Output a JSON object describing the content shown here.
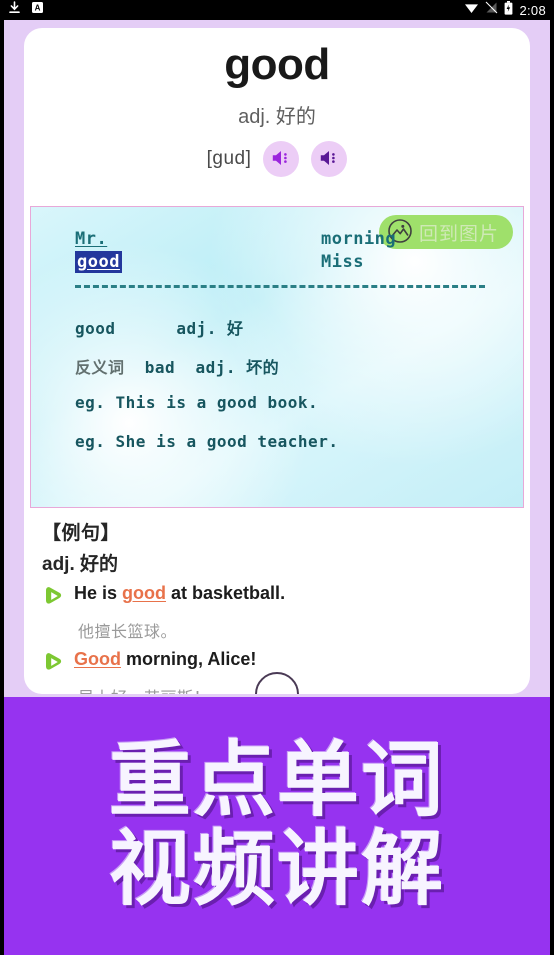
{
  "statusbar": {
    "time": "2:08",
    "icons": [
      {
        "name": "download-icon"
      },
      {
        "name": "app-badge-icon",
        "label": "A"
      },
      {
        "name": "wifi-icon"
      },
      {
        "name": "signal-off-icon"
      },
      {
        "name": "battery-icon"
      }
    ]
  },
  "word_card": {
    "title": "good",
    "part_of_speech": "adj. 好的",
    "phonetic": "[gud]",
    "speaker_uk": {
      "icon": "speaker-icon",
      "color": "#9b25dd"
    },
    "speaker_us": {
      "icon": "speaker-icon",
      "color": "#5a1896"
    }
  },
  "video_panel": {
    "back_button": {
      "label": "回到图片",
      "icon": "image-icon",
      "color": "#9fe06b"
    },
    "top_left_word": "Mr.",
    "top_left_highlight": "good",
    "top_right_line1": "morning",
    "top_right_line2": "Miss",
    "lines": [
      {
        "word": "good",
        "pos": "adj.",
        "cn": "好"
      },
      {
        "label": "反义词",
        "word": "bad",
        "pos": "adj.",
        "cn": "坏的"
      },
      {
        "eg": "eg. This is a good book."
      },
      {
        "eg": "eg. She is a good teacher."
      }
    ]
  },
  "examples": {
    "heading": "【例句】",
    "pos_label": "adj. 好的",
    "items": [
      {
        "en_before": "He is ",
        "en_highlight": "good",
        "en_after": " at basketball.",
        "cn": "他擅长篮球。"
      },
      {
        "en_before": "",
        "en_highlight": "Good",
        "en_after": " morning, Alice!",
        "cn": "早上好，艾丽斯！"
      }
    ]
  },
  "banner": {
    "line1": "重点单词",
    "line2": "视频讲解",
    "bg_color": "#9633f0",
    "text_color": "#f7f4ff"
  }
}
